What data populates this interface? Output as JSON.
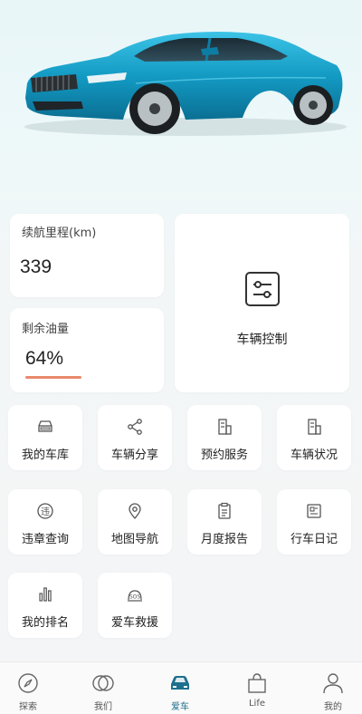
{
  "hero": {
    "car_image": "blue-sedan"
  },
  "range": {
    "label": "续航里程(km)",
    "value": "339"
  },
  "fuel": {
    "label": "剩余油量",
    "value": "64%",
    "level": 0.64
  },
  "control": {
    "label": "车辆控制",
    "icon": "sliders-icon"
  },
  "tiles": [
    {
      "label": "我的车库",
      "icon": "car-icon"
    },
    {
      "label": "车辆分享",
      "icon": "share-icon"
    },
    {
      "label": "预约服务",
      "icon": "building-icon"
    },
    {
      "label": "车辆状况",
      "icon": "building-icon"
    },
    {
      "label": "违章查询",
      "icon": "violation-icon"
    },
    {
      "label": "地图导航",
      "icon": "map-pin-icon"
    },
    {
      "label": "月度报告",
      "icon": "clipboard-icon"
    },
    {
      "label": "行车日记",
      "icon": "diary-icon"
    },
    {
      "label": "我的排名",
      "icon": "bar-chart-icon"
    },
    {
      "label": "爱车救援",
      "icon": "sos-icon"
    }
  ],
  "tabs": [
    {
      "label": "探索",
      "icon": "compass-icon",
      "active": false
    },
    {
      "label": "我们",
      "icon": "circles-icon",
      "active": false
    },
    {
      "label": "爱车",
      "icon": "car-icon",
      "active": true
    },
    {
      "label": "Life",
      "icon": "bag-icon",
      "active": false
    },
    {
      "label": "我的",
      "icon": "person-icon",
      "active": false
    }
  ],
  "colors": {
    "accent": "#1d6f8e",
    "fuel_bar": "#e8896b",
    "car_body": "#1aa3c8"
  }
}
